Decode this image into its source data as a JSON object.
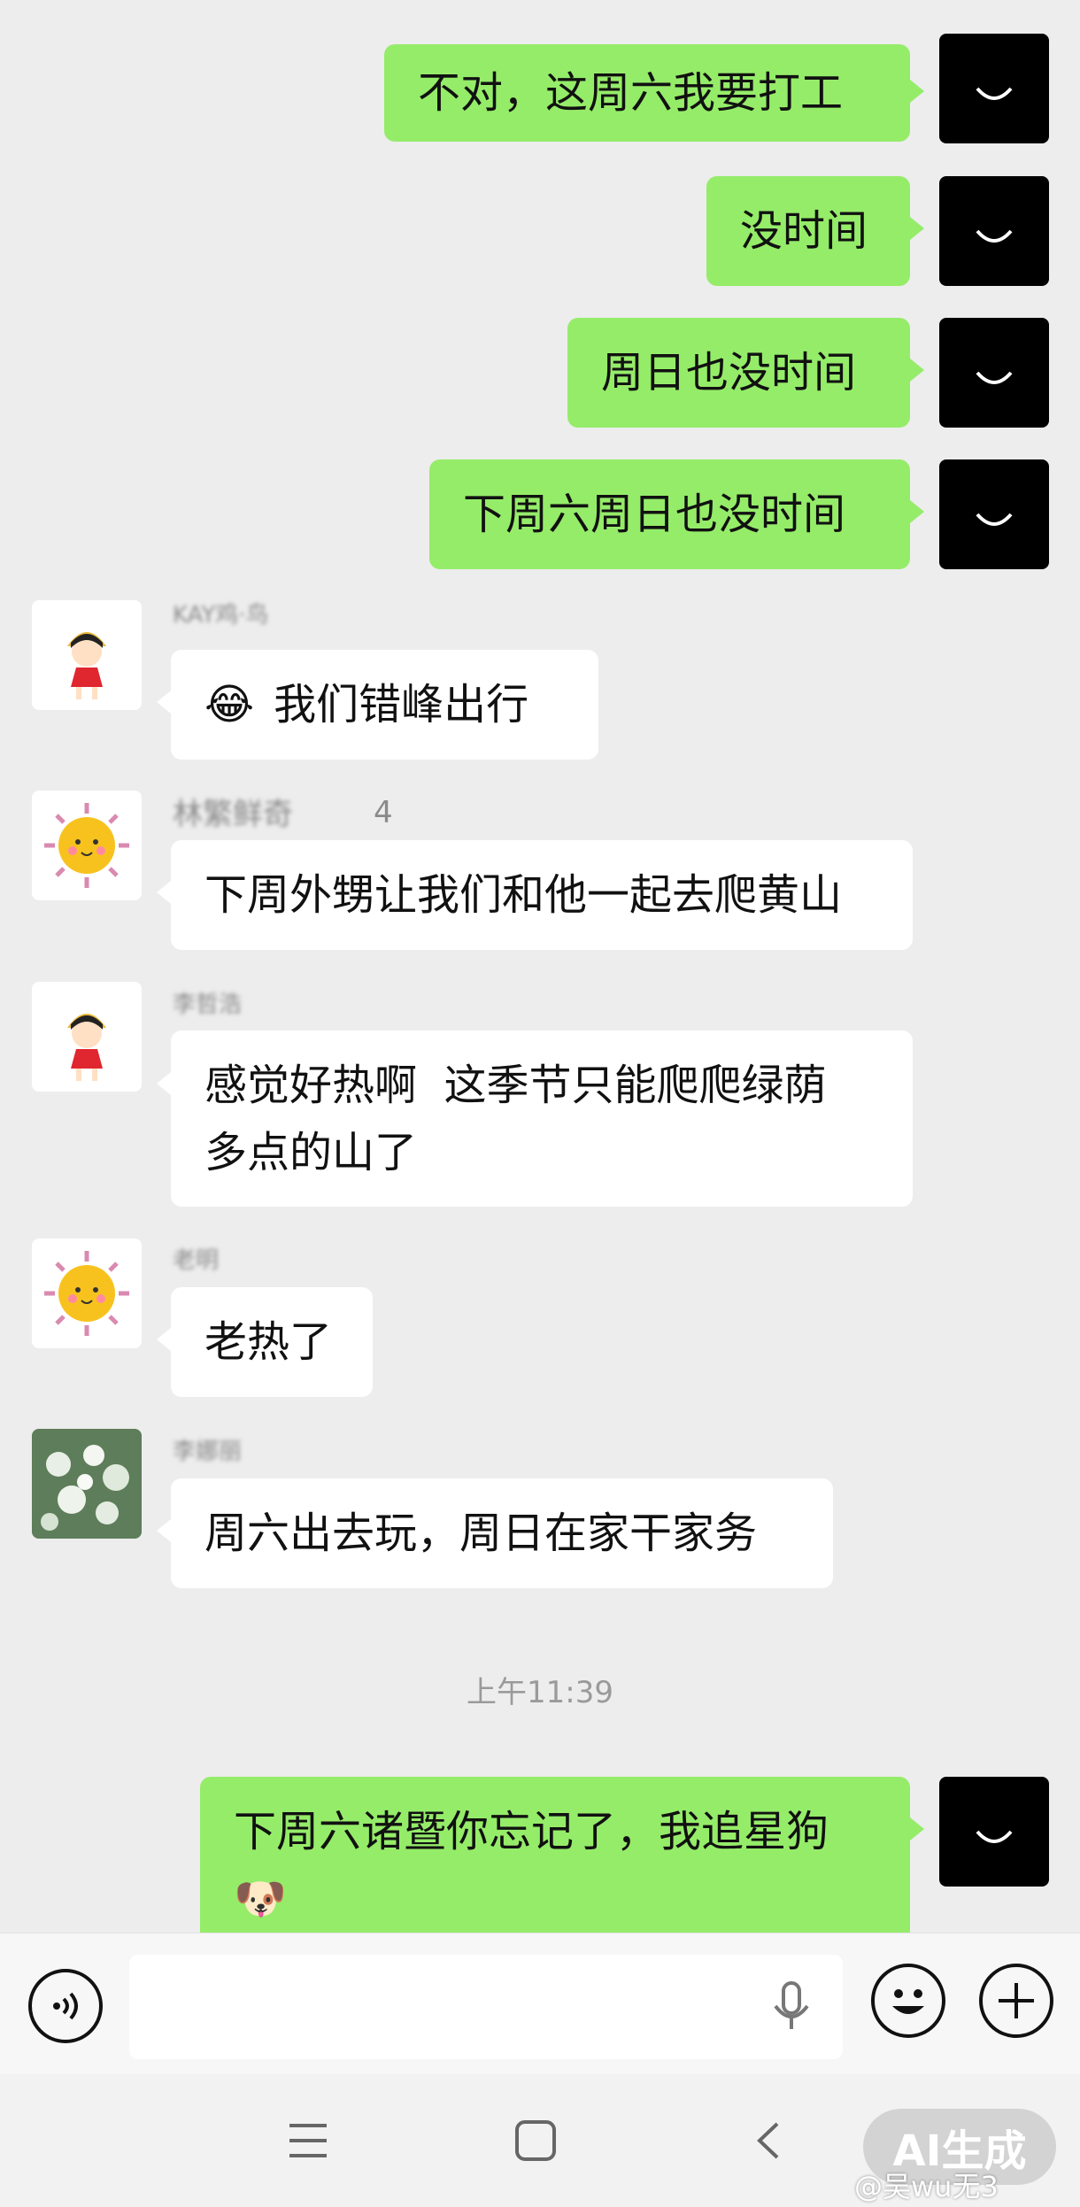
{
  "messages": {
    "m1": {
      "text": "不对，这周六我要打工"
    },
    "m2": {
      "text": "没时间"
    },
    "m3": {
      "text": "周日也没时间"
    },
    "m4": {
      "text": "下周六周日也没时间"
    },
    "m5": {
      "sender": "KAY鸡·鸟",
      "emoji": "😂",
      "text": "我们错峰出行"
    },
    "m6": {
      "sender": "林繁鲜奇",
      "suffix": "4",
      "text": "下周外甥让我们和他一起去爬黄山"
    },
    "m7": {
      "sender": "李哲浩",
      "line1": "感觉好热啊  这季节只能爬爬绿荫",
      "line2": "多点的山了"
    },
    "m8": {
      "sender": "老明",
      "text": "老热了"
    },
    "m9": {
      "sender": "李娜丽",
      "text": "周六出去玩，周日在家干家务"
    },
    "m10": {
      "line1": "下周六诸暨你忘记了，我追星狗",
      "line2": "🐶"
    }
  },
  "timestamp": "上午11:39",
  "input": {
    "placeholder": ""
  },
  "icons": {
    "voice": "voice-icon",
    "mic": "mic-icon",
    "emoji": "emoji-icon",
    "add": "add-icon",
    "menu": "menu-icon",
    "home": "home-icon",
    "back": "back-icon"
  },
  "colors": {
    "my_bubble": "#95ec69",
    "other_bubble": "#ffffff",
    "background": "#ededed"
  },
  "ai_badge": "AI生成",
  "watermark": "@吴wu无3"
}
